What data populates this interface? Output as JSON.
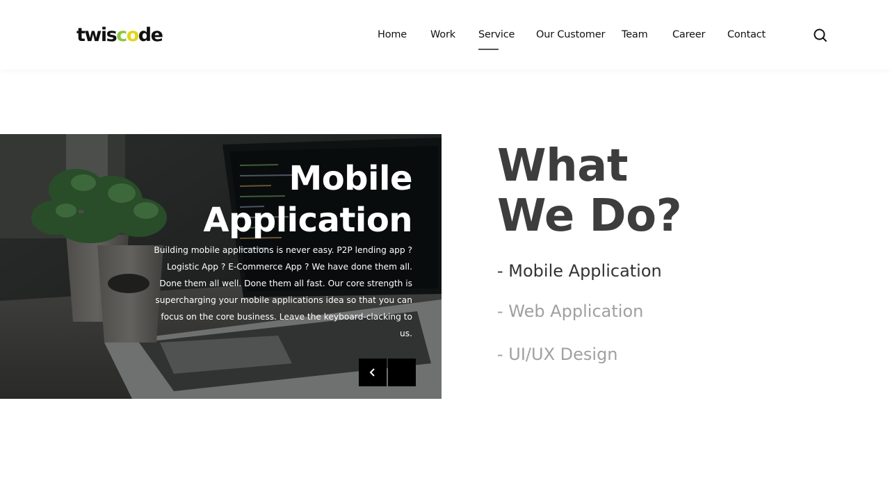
{
  "brand": {
    "logo_part1": "twis",
    "logo_c": "c",
    "logo_o": "o",
    "logo_part2": "de",
    "colors": {
      "c": "#8cc63f",
      "o": "#e3d51c",
      "text": "#111111"
    }
  },
  "nav": {
    "items": [
      {
        "label": "Home"
      },
      {
        "label": "Work"
      },
      {
        "label": "Service",
        "active": true
      },
      {
        "label": "Our Customer"
      },
      {
        "label": "Team"
      },
      {
        "label": "Career"
      },
      {
        "label": "Contact"
      }
    ],
    "search_icon": "search-icon"
  },
  "slider": {
    "title_line1": "Mobile",
    "title_line2": "Application",
    "description": "Building mobile applications is never easy. P2P lending app ? Logistic App ? E-Commerce App ? We have done them all. Done them all well. Done them all fast. Our core strength is supercharging your mobile applications idea so that you can focus on the core business. Leave the keyboard-clacking to us.",
    "prev_icon": "chevron-left-icon",
    "next_icon": "chevron-right-icon"
  },
  "section": {
    "title_line1": "What",
    "title_line2": "We Do?",
    "services": [
      {
        "label": "- Mobile Application",
        "active": true
      },
      {
        "label": "- Web Application",
        "active": false
      },
      {
        "label": "- UI/UX Design",
        "active": false
      }
    ]
  }
}
